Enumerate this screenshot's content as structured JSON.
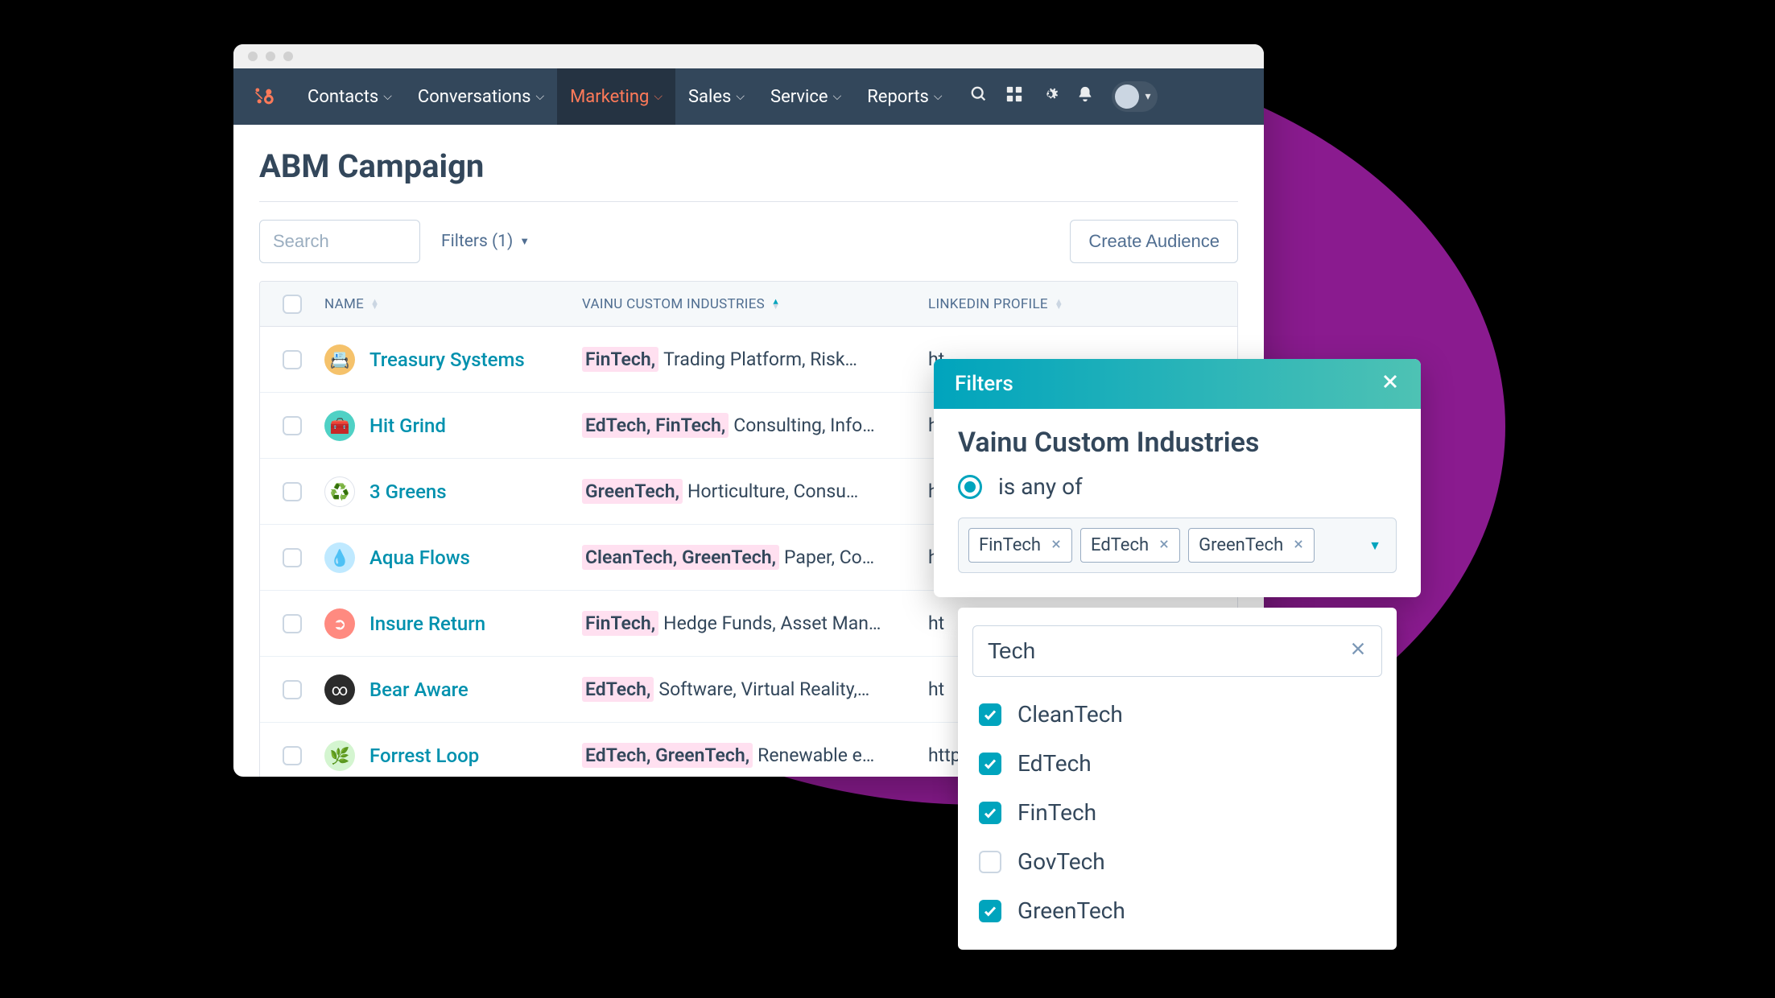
{
  "nav": {
    "items": [
      {
        "label": "Contacts",
        "active": false
      },
      {
        "label": "Conversations",
        "active": false
      },
      {
        "label": "Marketing",
        "active": true
      },
      {
        "label": "Sales",
        "active": false
      },
      {
        "label": "Service",
        "active": false
      },
      {
        "label": "Reports",
        "active": false
      }
    ]
  },
  "page": {
    "title": "ABM Campaign",
    "search_placeholder": "Search",
    "filters_label": "Filters (1)",
    "create_audience_label": "Create Audience"
  },
  "table": {
    "columns": {
      "name": "NAME",
      "industries": "VAINU CUSTOM INDUSTRIES",
      "linkedin": "LINKEDIN PROFILE"
    },
    "rows": [
      {
        "name": "Treasury Systems",
        "icon_bg": "#f5c26b",
        "icon_char": "📇",
        "highlighted": "FinTech,",
        "rest": "Trading Platform, Risk…",
        "link": "ht"
      },
      {
        "name": "Hit Grind",
        "icon_bg": "#4fd1c5",
        "icon_char": "🧰",
        "highlighted": "EdTech, FinTech,",
        "rest": "Consulting, Info…",
        "link": "ht"
      },
      {
        "name": "3 Greens",
        "icon_bg": "#ffffff",
        "icon_char": "♻️",
        "highlighted": "GreenTech,",
        "rest": "Horticulture, Consu…",
        "link": "ht"
      },
      {
        "name": "Aqua Flows",
        "icon_bg": "#bfe9ff",
        "icon_char": "💧",
        "highlighted": "CleanTech, GreenTech,",
        "rest": "Paper, Co…",
        "link": "ht"
      },
      {
        "name": "Insure Return",
        "icon_bg": "#ff8a80",
        "icon_char": "➲",
        "highlighted": "FinTech,",
        "rest": "Hedge Funds, Asset Man…",
        "link": "ht"
      },
      {
        "name": "Bear Aware",
        "icon_bg": "#2b2b2b",
        "icon_char": "∞",
        "highlighted": "EdTech,",
        "rest": "Software, Virtual Reality,…",
        "link": "ht"
      },
      {
        "name": "Forrest Loop",
        "icon_bg": "#d4f5d0",
        "icon_char": "🌿",
        "highlighted": "EdTech, GreenTech,",
        "rest": "Renewable e…",
        "link": "https"
      }
    ]
  },
  "filter_popover": {
    "header": "Filters",
    "title": "Vainu Custom Industries",
    "condition_label": "is any of",
    "chips": [
      "FinTech",
      "EdTech",
      "GreenTech"
    ],
    "search_value": "Tech",
    "options": [
      {
        "label": "CleanTech",
        "checked": true
      },
      {
        "label": "EdTech",
        "checked": true
      },
      {
        "label": "FinTech",
        "checked": true
      },
      {
        "label": "GovTech",
        "checked": false
      },
      {
        "label": "GreenTech",
        "checked": true
      }
    ]
  },
  "colors": {
    "accent": "#00a4bd",
    "brand_orange": "#ff7a59",
    "nav_bg": "#33475b",
    "purple": "#8a1b8f"
  }
}
